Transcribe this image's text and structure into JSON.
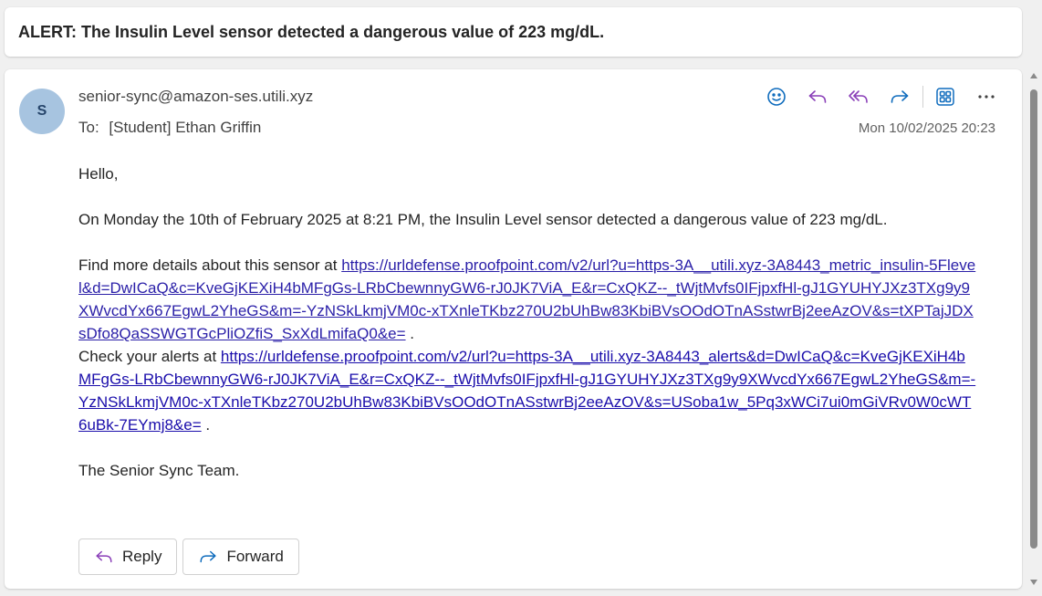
{
  "subject": "ALERT: The Insulin Level sensor detected a dangerous value of 223 mg/dL.",
  "message": {
    "avatar_initial": "S",
    "sender": "senior-sync@amazon-ses.utili.xyz",
    "to_label": "To:",
    "to_value": "[Student] Ethan Griffin",
    "timestamp": "Mon 10/02/2025 20:23",
    "actions": {
      "icons": [
        "emoji-icon",
        "reply-icon",
        "reply-all-icon",
        "forward-icon",
        "apps-icon",
        "more-icon"
      ]
    },
    "body": {
      "greeting": "Hello,",
      "paragraph1": "On Monday the 10th of February 2025 at 8:21 PM, the Insulin Level sensor detected a dangerous value of 223 mg/dL.",
      "details_prefix": "Find more details about this sensor at ",
      "details_link": "https://urldefense.proofpoint.com/v2/url?u=https-3A__utili.xyz-3A8443_metric_insulin-5Flevel&d=DwICaQ&c=KveGjKEXiH4bMFgGs-LRbCbewnnyGW6-rJ0JK7ViA_E&r=CxQKZ--_tWjtMvfs0IFjpxfHl-gJ1GYUHYJXz3TXg9y9XWvcdYx667EgwL2YheGS&m=-YzNSkLkmjVM0c-xTXnleTKbz270U2bUhBw83KbiBVsOOdOTnASstwrBj2eeAzOV&s=tXPTajJDXsDfo8QaSSWGTGcPliOZfiS_SxXdLmifaQ0&e=",
      "details_suffix": " .",
      "alerts_prefix": "Check your alerts at ",
      "alerts_link": "https://urldefense.proofpoint.com/v2/url?u=https-3A__utili.xyz-3A8443_alerts&d=DwICaQ&c=KveGjKEXiH4bMFgGs-LRbCbewnnyGW6-rJ0JK7ViA_E&r=CxQKZ--_tWjtMvfs0IFjpxfHl-gJ1GYUHYJXz3TXg9y9XWvcdYx667EgwL2YheGS&m=-YzNSkLkmjVM0c-xTXnleTKbz270U2bUhBw83KbiBVsOOdOTnASstwrBj2eeAzOV&s=USoba1w_5Pq3xWCi7ui0mGiVRv0W0cWT6uBk-7EYmj8&e=",
      "alerts_suffix": " .",
      "signoff": "The Senior Sync Team."
    },
    "reply_label": "Reply",
    "forward_label": "Forward"
  },
  "colors": {
    "accent_blue": "#0f6cbd",
    "reply_purple": "#8a3fb8",
    "link": "#1a0dab",
    "avatar_bg": "#a7c4e0"
  }
}
